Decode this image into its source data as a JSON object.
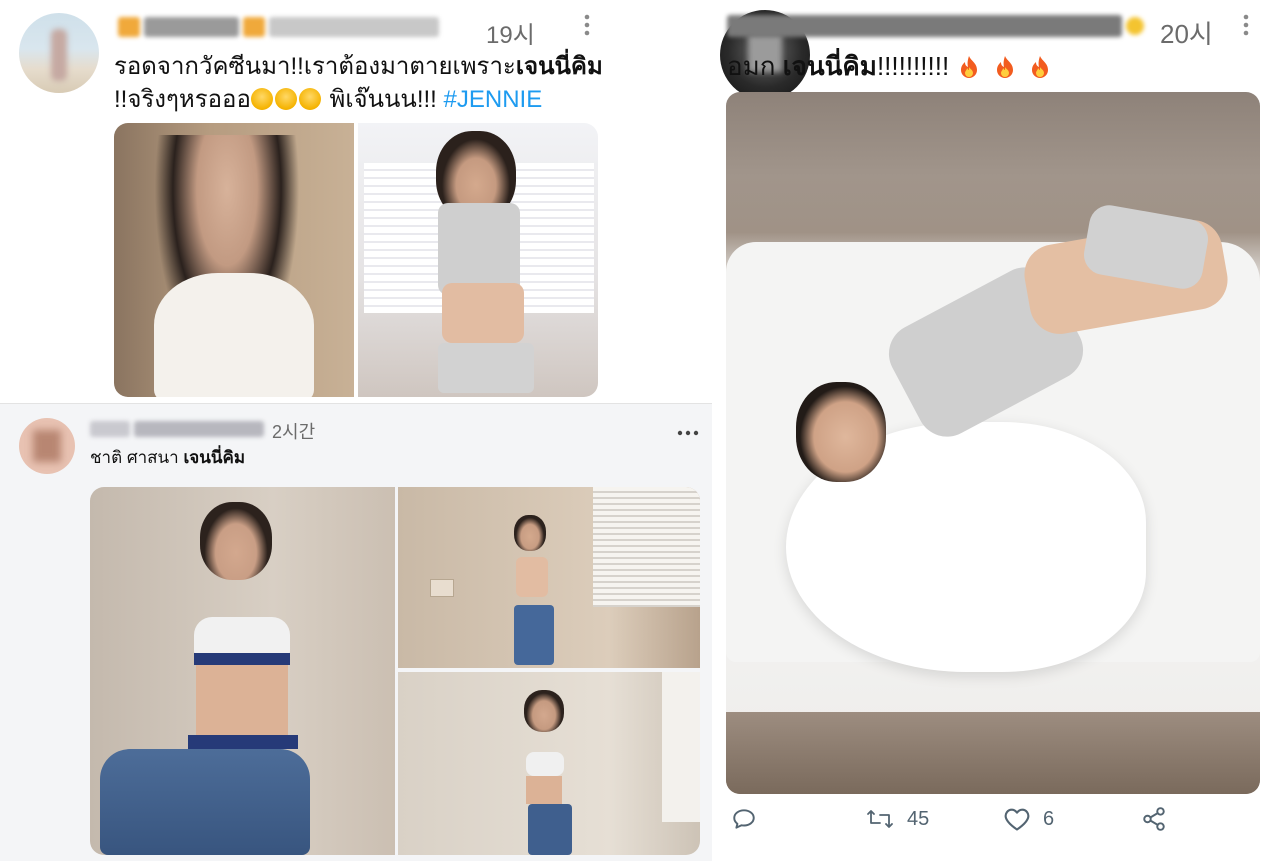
{
  "post_top_left": {
    "timestamp": "19시",
    "text_before": "รอดจากวัคซีนมา!!เราต้องมาตายเพราะ",
    "name_bold": "เจนนี่คิม",
    "text_line2_before": "!!จริงๆหรอออ",
    "text_after_emoji": " พิเจ๊นนน!!! ",
    "hashtag": "#JENNIE",
    "emoji": "sneezing-face-emoji",
    "more_icon": "more-vertical-icon"
  },
  "post_bottom_left": {
    "timestamp": "2시간",
    "text_before": "ชาติ ศาสนา ",
    "name_bold": "เจนนี่คิม",
    "more_icon": "more-horizontal-icon"
  },
  "post_right": {
    "timestamp": "20시",
    "text_before": "อมก ",
    "name_bold": "เจนนี่คิม",
    "text_after": "!!!!!!!!!! ",
    "emoji": "fire-emoji",
    "more_icon": "more-vertical-icon",
    "actions": {
      "reply_icon": "reply-icon",
      "retweet_icon": "retweet-icon",
      "retweet_count": "45",
      "like_icon": "heart-icon",
      "like_count": "6",
      "share_icon": "share-icon"
    }
  },
  "colors": {
    "hashtag": "#1d9bf0",
    "meta_text": "#6b6b6b",
    "action_icon": "#536471"
  }
}
